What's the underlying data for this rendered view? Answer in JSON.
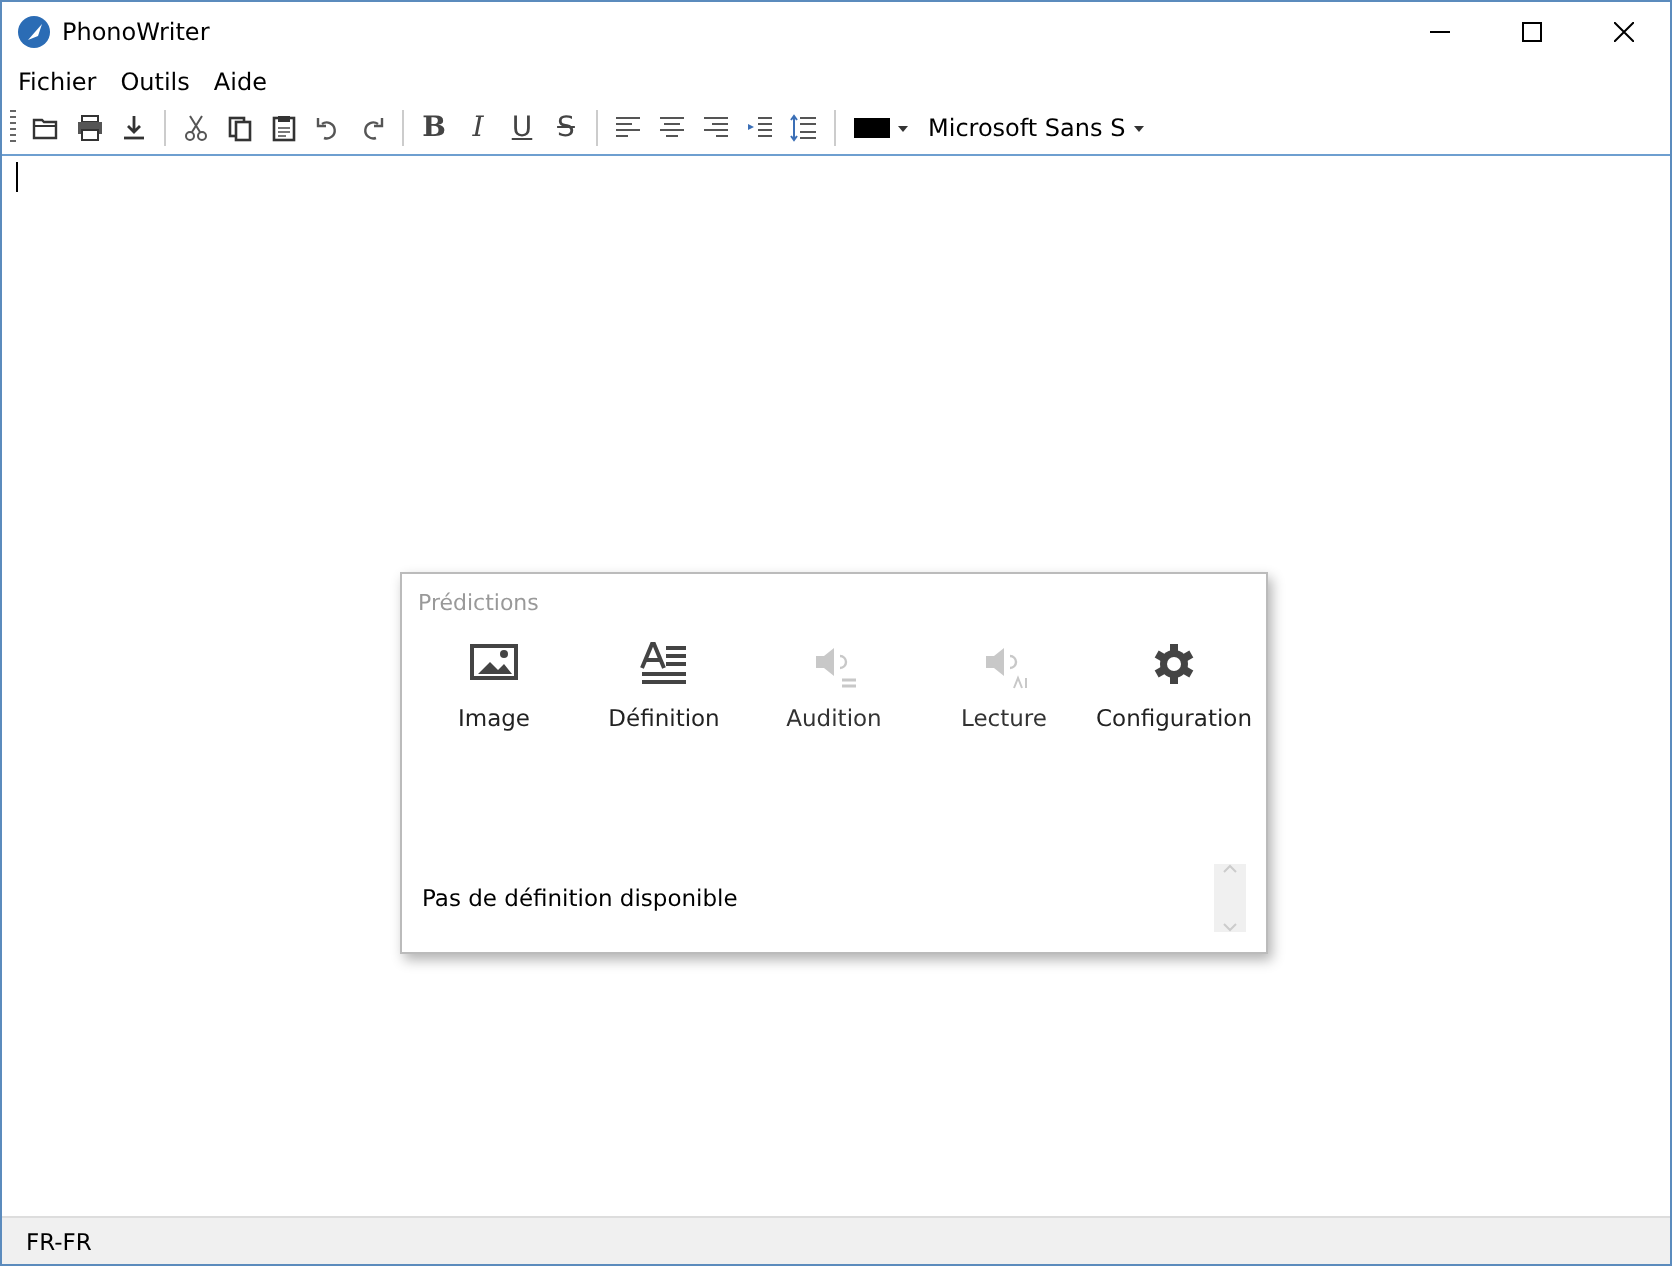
{
  "window": {
    "title": "PhonoWriter"
  },
  "menu": [
    "Fichier",
    "Outils",
    "Aide"
  ],
  "toolbar": [
    {
      "kind": "open"
    },
    {
      "kind": "print"
    },
    {
      "kind": "save"
    },
    {
      "kind": "sep"
    },
    {
      "kind": "cut"
    },
    {
      "kind": "copy"
    },
    {
      "kind": "paste"
    },
    {
      "kind": "undo"
    },
    {
      "kind": "redo"
    },
    {
      "kind": "sep"
    },
    {
      "kind": "bold",
      "label": "B"
    },
    {
      "kind": "italic",
      "label": "I"
    },
    {
      "kind": "underline",
      "label": "U"
    },
    {
      "kind": "strike",
      "label": "S"
    },
    {
      "kind": "sep"
    },
    {
      "kind": "align-left"
    },
    {
      "kind": "align-center"
    },
    {
      "kind": "align-right"
    },
    {
      "kind": "indent"
    },
    {
      "kind": "spacing"
    },
    {
      "kind": "sep"
    },
    {
      "kind": "color",
      "color": "#000000"
    },
    {
      "kind": "font",
      "label": "Microsoft Sans S"
    }
  ],
  "predictions": {
    "title": "Prédictions",
    "buttons": [
      {
        "kind": "image",
        "label": "Image",
        "disabled": false
      },
      {
        "kind": "definition",
        "label": "Définition",
        "disabled": false
      },
      {
        "kind": "audition",
        "label": "Audition",
        "disabled": true
      },
      {
        "kind": "reading",
        "label": "Lecture",
        "disabled": true
      },
      {
        "kind": "settings",
        "label": "Configuration",
        "disabled": false
      }
    ],
    "message": "Pas de définition disponible"
  },
  "status_bar": {
    "language": "FR-FR"
  }
}
